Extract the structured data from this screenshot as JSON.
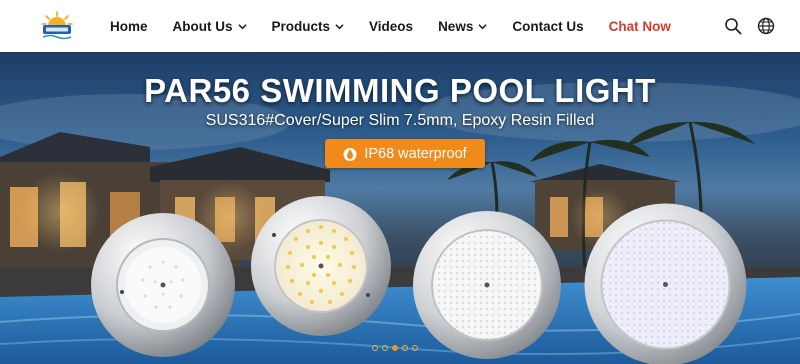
{
  "nav": {
    "items": [
      {
        "label": "Home",
        "has_dropdown": false
      },
      {
        "label": "About Us",
        "has_dropdown": true
      },
      {
        "label": "Products",
        "has_dropdown": true
      },
      {
        "label": "Videos",
        "has_dropdown": false
      },
      {
        "label": "News",
        "has_dropdown": true
      },
      {
        "label": "Contact Us",
        "has_dropdown": false
      },
      {
        "label": "Chat Now",
        "has_dropdown": false
      }
    ],
    "icons": [
      "search-icon",
      "globe-icon"
    ],
    "accent_color": "#d93a2b"
  },
  "hero": {
    "title": "PAR56 SWIMMING POOL LIGHT",
    "subtitle": "SUS316#Cover/Super Slim 7.5mm, Epoxy Resin Filled",
    "badge_label": "IP68 waterproof",
    "badge_icon": "water-drop-icon",
    "badge_color": "#f08a1a",
    "slides_total": 5,
    "slide_active": 3
  },
  "colors": {
    "nav_bg": "#ffffff",
    "text": "#1a1a1a",
    "dot_active": "#e69a22"
  }
}
